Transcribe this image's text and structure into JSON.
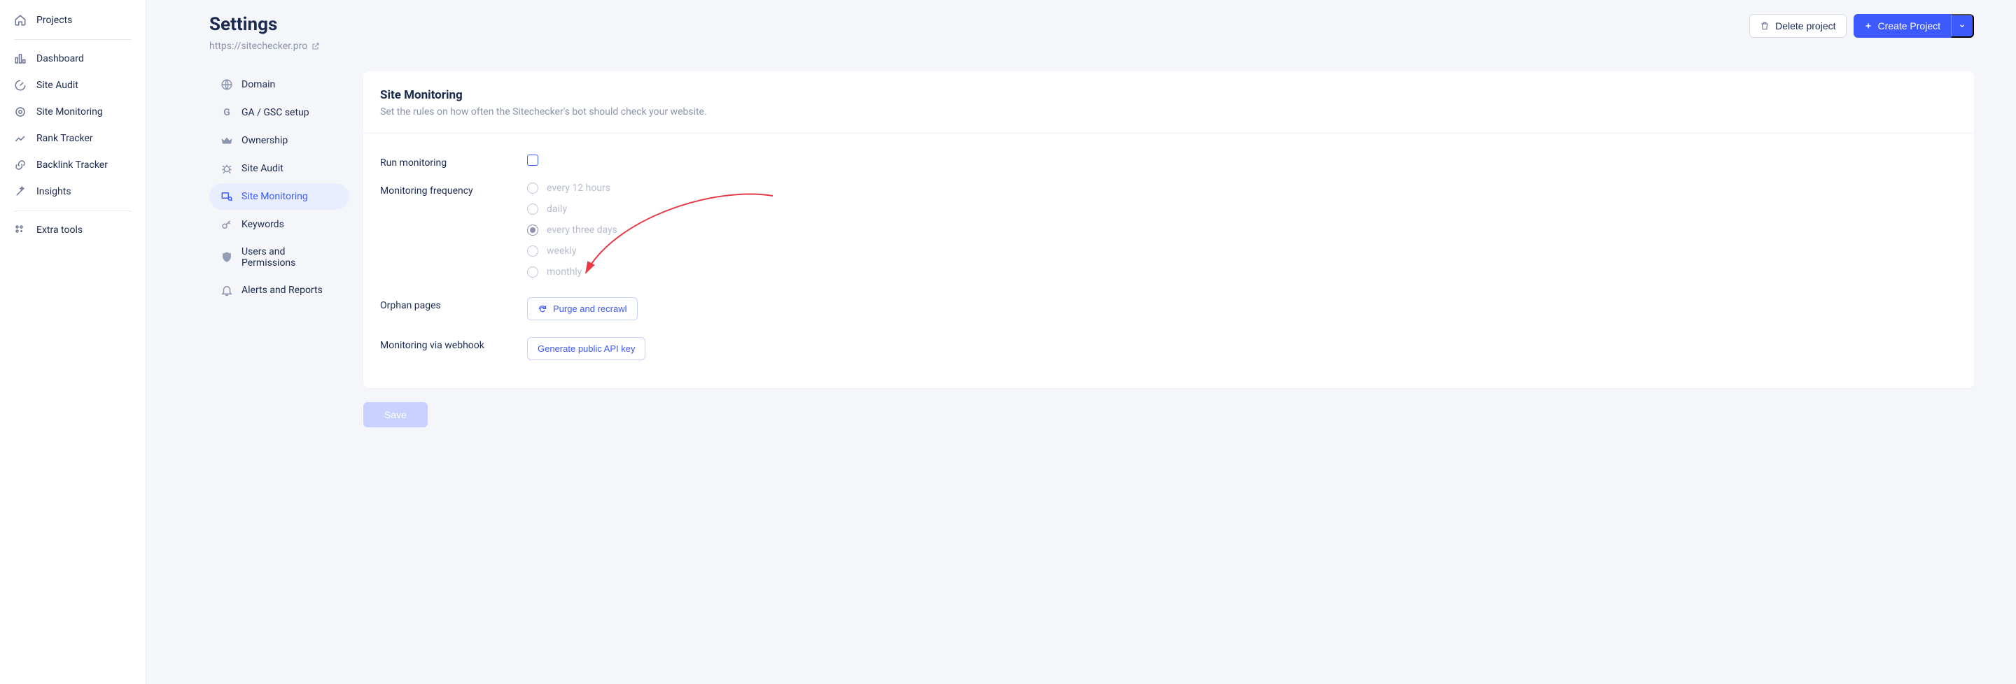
{
  "sidebar": {
    "projects": "Projects",
    "items": [
      {
        "label": "Dashboard"
      },
      {
        "label": "Site Audit"
      },
      {
        "label": "Site Monitoring"
      },
      {
        "label": "Rank Tracker"
      },
      {
        "label": "Backlink Tracker"
      },
      {
        "label": "Insights"
      }
    ],
    "extra": "Extra tools"
  },
  "header": {
    "title": "Settings",
    "site_url": "https://sitechecker.pro",
    "delete_label": "Delete project",
    "create_label": "Create Project"
  },
  "settings_nav": {
    "items": [
      {
        "label": "Domain"
      },
      {
        "label": "GA / GSC setup"
      },
      {
        "label": "Ownership"
      },
      {
        "label": "Site Audit"
      },
      {
        "label": "Site Monitoring"
      },
      {
        "label": "Keywords"
      },
      {
        "label": "Users and Permissions"
      },
      {
        "label": "Alerts and Reports"
      }
    ],
    "active_index": 4
  },
  "panel": {
    "title": "Site Monitoring",
    "description": "Set the rules on how often the Sitechecker's bot should check your website.",
    "rows": {
      "run_monitoring": "Run monitoring",
      "monitoring_frequency": "Monitoring frequency",
      "orphan_pages": "Orphan pages",
      "webhook": "Monitoring via webhook"
    },
    "frequency_options": [
      "every 12 hours",
      "daily",
      "every three days",
      "weekly",
      "monthly"
    ],
    "frequency_selected_index": 2,
    "purge_label": "Purge and recrawl",
    "api_key_label": "Generate public API key",
    "save_label": "Save"
  }
}
